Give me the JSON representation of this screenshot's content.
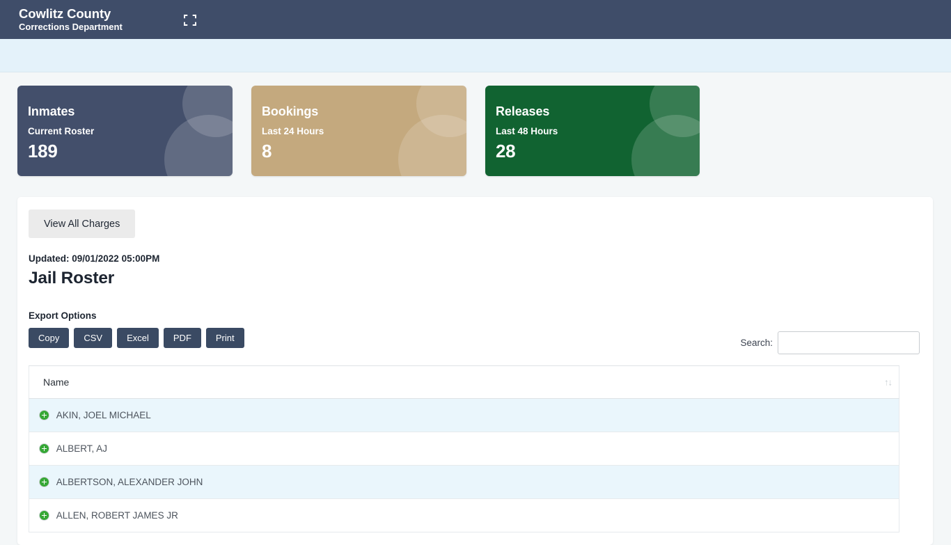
{
  "header": {
    "title": "Cowlitz County",
    "subtitle": "Corrections Department",
    "fullscreen_icon": "fullscreen-expand-icon"
  },
  "stat_cards": [
    {
      "title": "Inmates",
      "subtitle": "Current Roster",
      "value": "189",
      "color": "#434f6b"
    },
    {
      "title": "Bookings",
      "subtitle": "Last 24 Hours",
      "value": "8",
      "color": "#c4a97e"
    },
    {
      "title": "Releases",
      "subtitle": "Last 48 Hours",
      "value": "28",
      "color": "#116331"
    }
  ],
  "panel": {
    "view_all_charges_label": "View All Charges",
    "updated_text": "Updated: 09/01/2022 05:00PM",
    "page_title": "Jail Roster",
    "export_label": "Export Options",
    "export_buttons": [
      "Copy",
      "CSV",
      "Excel",
      "PDF",
      "Print"
    ],
    "search": {
      "label": "Search:",
      "value": "",
      "placeholder": ""
    },
    "table": {
      "columns": [
        "Name"
      ],
      "sort_glyph": "↑↓",
      "rows": [
        {
          "name": "AKIN, JOEL MICHAEL"
        },
        {
          "name": "ALBERT, AJ"
        },
        {
          "name": "ALBERTSON, ALEXANDER JOHN"
        },
        {
          "name": "ALLEN, ROBERT JAMES JR"
        }
      ]
    }
  }
}
